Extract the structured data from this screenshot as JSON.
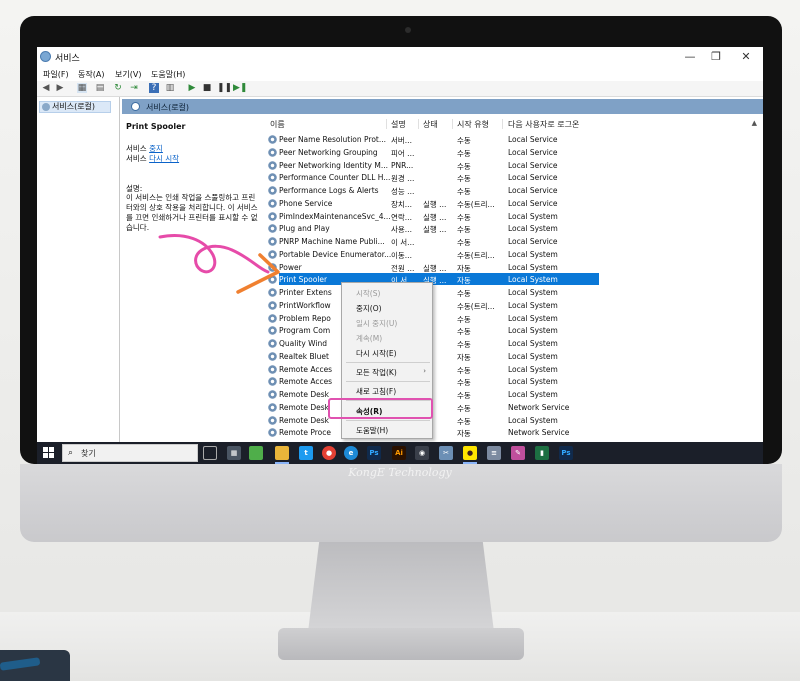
{
  "window": {
    "title": "서비스",
    "controls": [
      "—",
      "❐",
      "✕"
    ]
  },
  "menu": [
    "파일(F)",
    "동작(A)",
    "보기(V)",
    "도움말(H)"
  ],
  "toolbar_icons": [
    "back-arrow-icon",
    "forward-arrow-icon",
    "console-tree-icon",
    "properties-icon",
    "refresh-icon",
    "export-icon",
    "help-icon",
    "details-icon",
    "start-icon",
    "stop-icon",
    "pause-icon",
    "restart-icon"
  ],
  "tree": {
    "root_label": "서비스(로컬)"
  },
  "header": {
    "label": "서비스(로컬)"
  },
  "details": {
    "service_name": "Print Spooler",
    "stop_prefix": "서비스",
    "stop_link": "중지",
    "restart_prefix": "서비스",
    "restart_link": "다시 시작",
    "desc_label": "설명:",
    "desc_text": "이 서비스는 인쇄 작업을 스풀링하고 프린터와의 상호 작용을 처리합니다. 이 서비스를 끄면 인쇄하거나 프린터를 표시할 수 없습니다."
  },
  "columns": [
    "이름",
    "설명",
    "상태",
    "시작 유형",
    "다음 사용자로 로그온"
  ],
  "rows": [
    {
      "name": "Peer Name Resolution Prot...",
      "desc": "서버...",
      "status": "",
      "startup": "수동",
      "logon": "Local Service"
    },
    {
      "name": "Peer Networking Grouping",
      "desc": "피어 ...",
      "status": "",
      "startup": "수동",
      "logon": "Local Service"
    },
    {
      "name": "Peer Networking Identity M...",
      "desc": "PNR...",
      "status": "",
      "startup": "수동",
      "logon": "Local Service"
    },
    {
      "name": "Performance Counter DLL H...",
      "desc": "원경 ...",
      "status": "",
      "startup": "수동",
      "logon": "Local Service"
    },
    {
      "name": "Performance Logs & Alerts",
      "desc": "성능 ...",
      "status": "",
      "startup": "수동",
      "logon": "Local Service"
    },
    {
      "name": "Phone Service",
      "desc": "장치...",
      "status": "실행 ...",
      "startup": "수동(트리...",
      "logon": "Local Service"
    },
    {
      "name": "PimIndexMaintenanceSvc_4...",
      "desc": "연락...",
      "status": "실행 ...",
      "startup": "수동",
      "logon": "Local System"
    },
    {
      "name": "Plug and Play",
      "desc": "사용...",
      "status": "실행 ...",
      "startup": "수동",
      "logon": "Local System"
    },
    {
      "name": "PNRP Machine Name Publi...",
      "desc": "이 서...",
      "status": "",
      "startup": "수동",
      "logon": "Local Service"
    },
    {
      "name": "Portable Device Enumerator...",
      "desc": "이동...",
      "status": "",
      "startup": "수동(트리...",
      "logon": "Local System"
    },
    {
      "name": "Power",
      "desc": "전원 ...",
      "status": "실행 ...",
      "startup": "자동",
      "logon": "Local System"
    },
    {
      "name": "Print Spooler",
      "desc": "이 서...",
      "status": "실행 ...",
      "startup": "자동",
      "logon": "Local System"
    },
    {
      "name": "Printer Extens",
      "desc": "",
      "status": "",
      "startup": "수동",
      "logon": "Local System"
    },
    {
      "name": "PrintWorkflow",
      "desc": "",
      "status": "",
      "startup": "수동(트리...",
      "logon": "Local System"
    },
    {
      "name": "Problem Repo",
      "desc": "",
      "status": "",
      "startup": "수동",
      "logon": "Local System"
    },
    {
      "name": "Program Com",
      "desc": "",
      "status": "",
      "startup": "수동",
      "logon": "Local System"
    },
    {
      "name": "Quality Wind",
      "desc": "",
      "status": "",
      "startup": "수동",
      "logon": "Local System"
    },
    {
      "name": "Realtek Bluet",
      "desc": "",
      "status": "",
      "startup": "자동",
      "logon": "Local System"
    },
    {
      "name": "Remote Acces",
      "desc": "",
      "status": "",
      "startup": "수동",
      "logon": "Local System"
    },
    {
      "name": "Remote Acces",
      "desc": "",
      "status": "",
      "startup": "수동",
      "logon": "Local System"
    },
    {
      "name": "Remote Desk",
      "desc": "",
      "status": "",
      "startup": "수동",
      "logon": "Local System"
    },
    {
      "name": "Remote Desk",
      "desc": "",
      "status": "",
      "startup": "수동",
      "logon": "Network Service"
    },
    {
      "name": "Remote Desk",
      "desc": "",
      "status": "",
      "startup": "수동",
      "logon": "Local System"
    },
    {
      "name": "Remote Proce",
      "desc": "",
      "status": "",
      "startup": "자동",
      "logon": "Network Service"
    }
  ],
  "context_menu": {
    "start": "시작(S)",
    "stop": "중지(O)",
    "pause": "일시 중지(U)",
    "resume": "계속(M)",
    "restart": "다시 시작(E)",
    "all_tasks": "모든 작업(K)",
    "refresh": "새로 고침(F)",
    "properties": "속성(R)",
    "help": "도움말(H)"
  },
  "taskbar": {
    "search_placeholder": "찾기",
    "apps": [
      "task-view-icon",
      "calculator-icon",
      "photos-icon",
      "file-explorer-icon",
      "twitter-icon",
      "chrome-icon",
      "edge-icon",
      "photoshop-icon",
      "illustrator-icon",
      "camera-icon",
      "snipping-icon",
      "kakaotalk-icon",
      "notepad-icon",
      "paint-icon",
      "excel-icon",
      "photoshop-icon-2"
    ]
  },
  "chin_label": "KongE Technology",
  "colors": {
    "selection": "#0a78d7",
    "highlight": "#e052b0",
    "header_strip": "#7fa1c6",
    "taskbar": "#1b1f29"
  }
}
